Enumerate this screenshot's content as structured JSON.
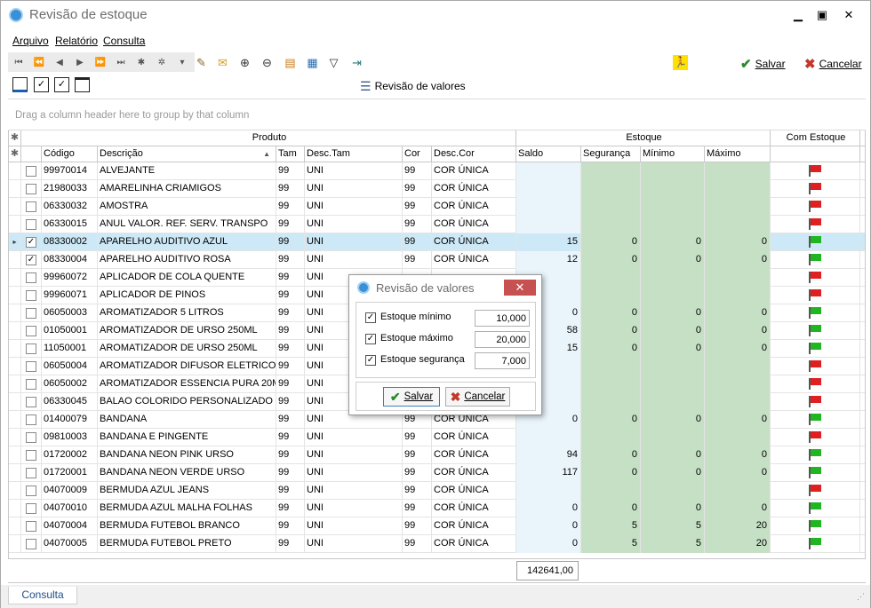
{
  "window": {
    "title": "Revisão de estoque",
    "minimize": "▁",
    "maximize": "▣",
    "close": "✕"
  },
  "menu": [
    "Arquivo",
    "Relatório",
    "Consulta"
  ],
  "toolbar": {
    "nav_icons": [
      "⏮",
      "⏪",
      "◀",
      "▶",
      "⏩",
      "⏭",
      "✱",
      "✲",
      "▾"
    ],
    "save_label": "Salvar",
    "cancel_label": "Cancelar",
    "review_label": "Revisão de valores"
  },
  "group_panel_text": "Drag a column header here to group by that column",
  "headers": {
    "band_produto": "Produto",
    "band_estoque": "Estoque",
    "band_com_estoque": "Com Estoque",
    "codigo": "Código",
    "descricao": "Descrição",
    "tam": "Tam",
    "desc_tam": "Desc.Tam",
    "cor": "Cor",
    "desc_cor": "Desc.Cor",
    "saldo": "Saldo",
    "seguranca": "Segurança",
    "minimo": "Mínimo",
    "maximo": "Máximo"
  },
  "rows": [
    {
      "checked": false,
      "codigo": "99970014",
      "descricao": "ALVEJANTE",
      "tam": "99",
      "desc_tam": "UNI",
      "cor": "99",
      "desc_cor": "COR ÚNICA",
      "saldo": "",
      "seg": "",
      "min": "",
      "max": "",
      "flag": "red"
    },
    {
      "checked": false,
      "codigo": "21980033",
      "descricao": "AMARELINHA CRIAMIGOS",
      "tam": "99",
      "desc_tam": "UNI",
      "cor": "99",
      "desc_cor": "COR ÚNICA",
      "saldo": "",
      "seg": "",
      "min": "",
      "max": "",
      "flag": "red"
    },
    {
      "checked": false,
      "codigo": "06330032",
      "descricao": "AMOSTRA",
      "tam": "99",
      "desc_tam": "UNI",
      "cor": "99",
      "desc_cor": "COR ÚNICA",
      "saldo": "",
      "seg": "",
      "min": "",
      "max": "",
      "flag": "red"
    },
    {
      "checked": false,
      "codigo": "06330015",
      "descricao": "ANUL VALOR. REF. SERV. TRANSPO",
      "tam": "99",
      "desc_tam": "UNI",
      "cor": "99",
      "desc_cor": "COR ÚNICA",
      "saldo": "",
      "seg": "",
      "min": "",
      "max": "",
      "flag": "red"
    },
    {
      "checked": true,
      "selected": true,
      "codigo": "08330002",
      "descricao": "APARELHO AUDITIVO AZUL",
      "tam": "99",
      "desc_tam": "UNI",
      "cor": "99",
      "desc_cor": "COR ÚNICA",
      "saldo": "15",
      "seg": "0",
      "min": "0",
      "max": "0",
      "flag": "green"
    },
    {
      "checked": true,
      "codigo": "08330004",
      "descricao": "APARELHO AUDITIVO ROSA",
      "tam": "99",
      "desc_tam": "UNI",
      "cor": "99",
      "desc_cor": "COR ÚNICA",
      "saldo": "12",
      "seg": "0",
      "min": "0",
      "max": "0",
      "flag": "green"
    },
    {
      "checked": false,
      "codigo": "99960072",
      "descricao": "APLICADOR DE COLA QUENTE",
      "tam": "99",
      "desc_tam": "UNI",
      "cor": "",
      "desc_cor": "",
      "saldo": "",
      "seg": "",
      "min": "",
      "max": "",
      "flag": "red"
    },
    {
      "checked": false,
      "codigo": "99960071",
      "descricao": "APLICADOR DE PINOS",
      "tam": "99",
      "desc_tam": "UNI",
      "cor": "",
      "desc_cor": "",
      "saldo": "",
      "seg": "",
      "min": "",
      "max": "",
      "flag": "red"
    },
    {
      "checked": false,
      "codigo": "06050003",
      "descricao": "AROMATIZADOR 5 LITROS",
      "tam": "99",
      "desc_tam": "UNI",
      "cor": "",
      "desc_cor": "",
      "saldo": "0",
      "seg": "0",
      "min": "0",
      "max": "0",
      "flag": "green"
    },
    {
      "checked": false,
      "codigo": "01050001",
      "descricao": "AROMATIZADOR DE URSO 250ML",
      "tam": "99",
      "desc_tam": "UNI",
      "cor": "",
      "desc_cor": "",
      "saldo": "58",
      "seg": "0",
      "min": "0",
      "max": "0",
      "flag": "green"
    },
    {
      "checked": false,
      "codigo": "11050001",
      "descricao": "AROMATIZADOR DE URSO 250ML",
      "tam": "99",
      "desc_tam": "UNI",
      "cor": "",
      "desc_cor": "",
      "saldo": "15",
      "seg": "0",
      "min": "0",
      "max": "0",
      "flag": "green"
    },
    {
      "checked": false,
      "codigo": "06050004",
      "descricao": "AROMATIZADOR DIFUSOR ELETRICO",
      "tam": "99",
      "desc_tam": "UNI",
      "cor": "",
      "desc_cor": "",
      "saldo": "",
      "seg": "",
      "min": "",
      "max": "",
      "flag": "red"
    },
    {
      "checked": false,
      "codigo": "06050002",
      "descricao": "AROMATIZADOR ESSENCIA PURA 20M",
      "tam": "99",
      "desc_tam": "UNI",
      "cor": "",
      "desc_cor": "",
      "saldo": "",
      "seg": "",
      "min": "",
      "max": "",
      "flag": "red"
    },
    {
      "checked": false,
      "codigo": "06330045",
      "descricao": "BALAO COLORIDO PERSONALIZADO",
      "tam": "99",
      "desc_tam": "UNI",
      "cor": "",
      "desc_cor": "",
      "saldo": "",
      "seg": "",
      "min": "",
      "max": "",
      "flag": "red"
    },
    {
      "checked": false,
      "codigo": "01400079",
      "descricao": "BANDANA",
      "tam": "99",
      "desc_tam": "UNI",
      "cor": "99",
      "desc_cor": "COR ÚNICA",
      "saldo": "0",
      "seg": "0",
      "min": "0",
      "max": "0",
      "flag": "green"
    },
    {
      "checked": false,
      "codigo": "09810003",
      "descricao": "BANDANA E PINGENTE",
      "tam": "99",
      "desc_tam": "UNI",
      "cor": "99",
      "desc_cor": "COR ÚNICA",
      "saldo": "",
      "seg": "",
      "min": "",
      "max": "",
      "flag": "red"
    },
    {
      "checked": false,
      "codigo": "01720002",
      "descricao": "BANDANA NEON PINK URSO",
      "tam": "99",
      "desc_tam": "UNI",
      "cor": "99",
      "desc_cor": "COR ÚNICA",
      "saldo": "94",
      "seg": "0",
      "min": "0",
      "max": "0",
      "flag": "green"
    },
    {
      "checked": false,
      "codigo": "01720001",
      "descricao": "BANDANA NEON VERDE URSO",
      "tam": "99",
      "desc_tam": "UNI",
      "cor": "99",
      "desc_cor": "COR ÚNICA",
      "saldo": "117",
      "seg": "0",
      "min": "0",
      "max": "0",
      "flag": "green"
    },
    {
      "checked": false,
      "codigo": "04070009",
      "descricao": "BERMUDA AZUL JEANS",
      "tam": "99",
      "desc_tam": "UNI",
      "cor": "99",
      "desc_cor": "COR ÚNICA",
      "saldo": "",
      "seg": "",
      "min": "",
      "max": "",
      "flag": "red"
    },
    {
      "checked": false,
      "codigo": "04070010",
      "descricao": "BERMUDA AZUL MALHA FOLHAS",
      "tam": "99",
      "desc_tam": "UNI",
      "cor": "99",
      "desc_cor": "COR ÚNICA",
      "saldo": "0",
      "seg": "0",
      "min": "0",
      "max": "0",
      "flag": "green"
    },
    {
      "checked": false,
      "codigo": "04070004",
      "descricao": "BERMUDA FUTEBOL BRANCO",
      "tam": "99",
      "desc_tam": "UNI",
      "cor": "99",
      "desc_cor": "COR ÚNICA",
      "saldo": "0",
      "seg": "5",
      "min": "5",
      "max": "20",
      "flag": "green"
    },
    {
      "checked": false,
      "codigo": "04070005",
      "descricao": "BERMUDA FUTEBOL PRETO",
      "tam": "99",
      "desc_tam": "UNI",
      "cor": "99",
      "desc_cor": "COR ÚNICA",
      "saldo": "0",
      "seg": "5",
      "min": "5",
      "max": "20",
      "flag": "green"
    }
  ],
  "total_saldo": "142641,00",
  "status_tab": "Consulta",
  "dialog": {
    "title": "Revisão de valores",
    "close": "✕",
    "fields": [
      {
        "label": "Estoque mínimo",
        "value": "10,000",
        "checked": true
      },
      {
        "label": "Estoque máximo",
        "value": "20,000",
        "checked": true
      },
      {
        "label": "Estoque segurança",
        "value": "7,000",
        "checked": true
      }
    ],
    "save_label": "Salvar",
    "cancel_label": "Cancelar"
  },
  "colors": {
    "green_cell": "#c6e0c6",
    "saldo_cell": "#eaf5fb",
    "selected_row": "#cde8f6",
    "flag_red": "#e02020",
    "flag_green": "#22b522"
  }
}
